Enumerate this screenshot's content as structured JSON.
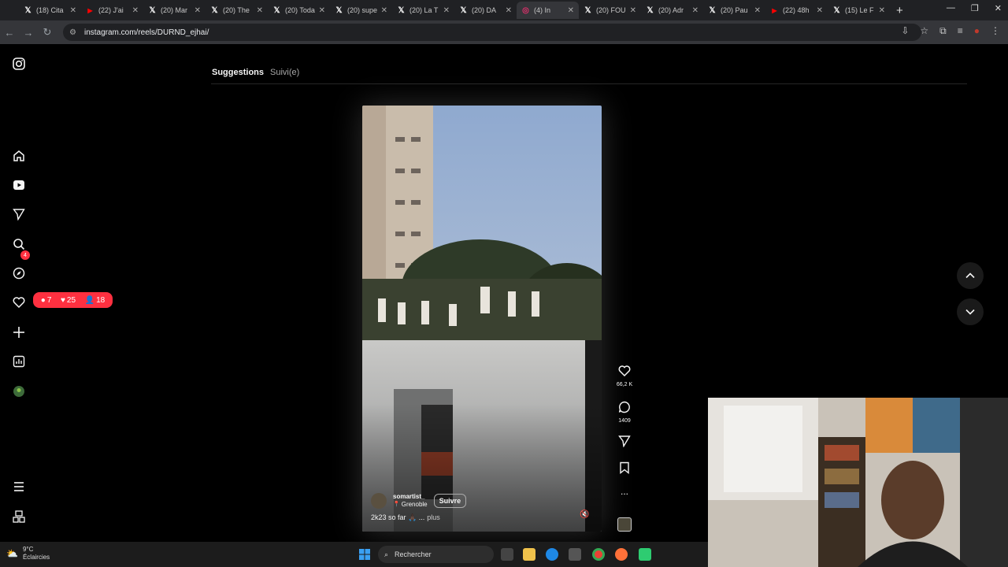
{
  "browser": {
    "tabs": [
      {
        "title": "(18) Cita",
        "icon": "x-logo"
      },
      {
        "title": "(22) J'ai",
        "icon": "youtube-logo"
      },
      {
        "title": "(20) Mar",
        "icon": "x-logo"
      },
      {
        "title": "(20) The",
        "icon": "x-logo"
      },
      {
        "title": "(20) Toda",
        "icon": "x-logo"
      },
      {
        "title": "(20) supe",
        "icon": "x-logo"
      },
      {
        "title": "(20) La T",
        "icon": "x-logo"
      },
      {
        "title": "(20) DA",
        "icon": "x-logo"
      },
      {
        "title": "(4) In",
        "icon": "instagram-logo",
        "active": true
      },
      {
        "title": "(20) FOU",
        "icon": "x-logo"
      },
      {
        "title": "(20) Adr",
        "icon": "x-logo"
      },
      {
        "title": "(20) Pau",
        "icon": "x-logo"
      },
      {
        "title": "(22) 48h",
        "icon": "youtube-logo"
      },
      {
        "title": "(15) Le F",
        "icon": "x-logo"
      }
    ],
    "url": "instagram.com/reels/DURND_ejhai/"
  },
  "sidebar": {
    "notification_count": "4",
    "activity": {
      "comments": "7",
      "likes": "25",
      "follows": "18"
    }
  },
  "feed_tabs": {
    "suggestions": "Suggestions",
    "following": "Suivi(e)"
  },
  "reel": {
    "likes": "66,2 K",
    "comments": "1409",
    "username": "somartist_",
    "location": "Grenoble",
    "follow_label": "Suivre",
    "caption": "2k23 so far 🙏🏿 ...",
    "more_label": "plus",
    "more_dots": "..."
  },
  "taskbar": {
    "temperature": "9°C",
    "weather": "Éclaircies",
    "search_placeholder": "Rechercher"
  },
  "colors": {
    "accent_red": "#ff3040",
    "chrome_dark": "#202124",
    "chrome_mid": "#35363a"
  }
}
